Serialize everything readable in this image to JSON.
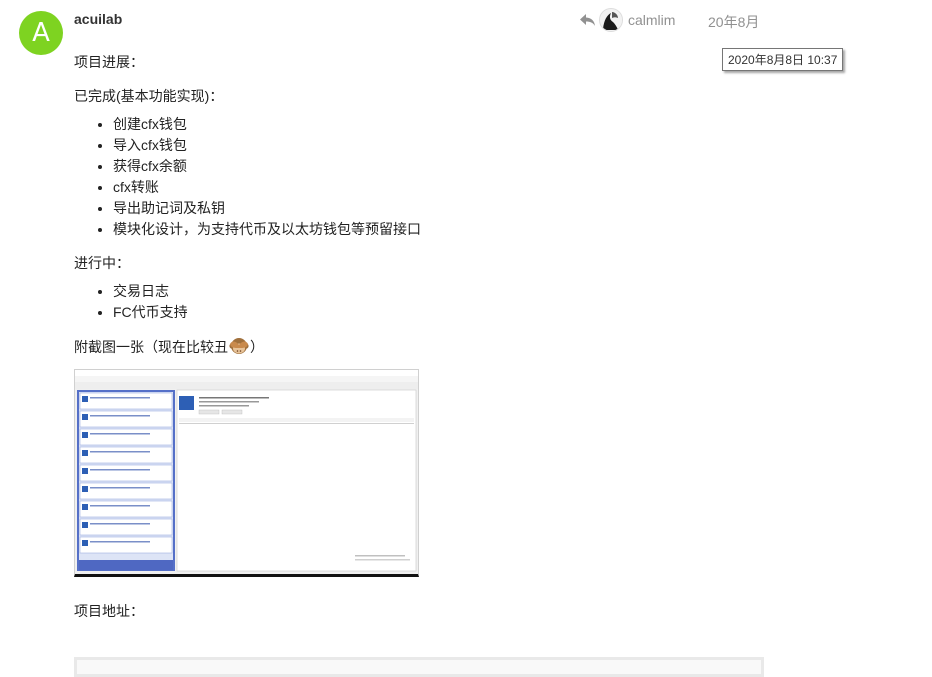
{
  "post": {
    "author_initial": "A",
    "author_name": "acuilab",
    "avatar_color": "#7ed321",
    "reply_to_user": "calmlim",
    "date_short": "20年8月",
    "date_tooltip": "2020年8月8日 10:37",
    "body": {
      "heading_progress": "项目进展：",
      "completed_label": "已完成(基本功能实现)：",
      "completed_items": [
        "创建cfx钱包",
        "导入cfx钱包",
        "获得cfx余额",
        "cfx转账",
        "导出助记词及私钥",
        "模块化设计，为支持代币及以太坊钱包等预留接口"
      ],
      "in_progress_label": "进行中：",
      "in_progress_items": [
        "交易日志",
        "FC代币支持"
      ],
      "attachment_text_before": "附截图一张（现在比较丑",
      "attachment_text_after": "）",
      "emoji_name": "see-no-evil-monkey-icon",
      "project_address_label": "项目地址："
    }
  },
  "icons": {
    "reply": "reply-arrow-icon",
    "reply_avatar": "user-avatar-icon"
  }
}
